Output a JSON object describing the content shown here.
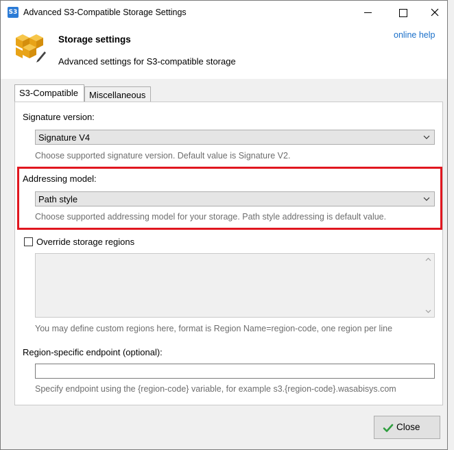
{
  "window": {
    "app_icon_text": "S3",
    "title": "Advanced S3-Compatible Storage Settings"
  },
  "header": {
    "title": "Storage settings",
    "subtitle": "Advanced settings for S3-compatible storage",
    "online_help": "online help"
  },
  "tabs": [
    {
      "label": "S3-Compatible",
      "active": true
    },
    {
      "label": "Miscellaneous",
      "active": false
    }
  ],
  "signature": {
    "label": "Signature version:",
    "value": "Signature V4",
    "hint": "Choose supported signature version. Default value is Signature V2."
  },
  "addressing": {
    "label": "Addressing model:",
    "value": "Path style",
    "hint": "Choose supported addressing model for your storage. Path style addressing is default value."
  },
  "regions": {
    "checkbox_label": "Override storage regions",
    "checked": false,
    "hint": "You may define custom regions here, format is Region Name=region-code, one region per line"
  },
  "endpoint": {
    "label": "Region-specific endpoint (optional):",
    "value": "",
    "hint": "Specify endpoint using the {region-code} variable, for example s3.{region-code}.wasabisys.com"
  },
  "footer": {
    "close_label": "Close"
  },
  "colors": {
    "highlight": "#e0161f",
    "link": "#1a6fc9"
  }
}
